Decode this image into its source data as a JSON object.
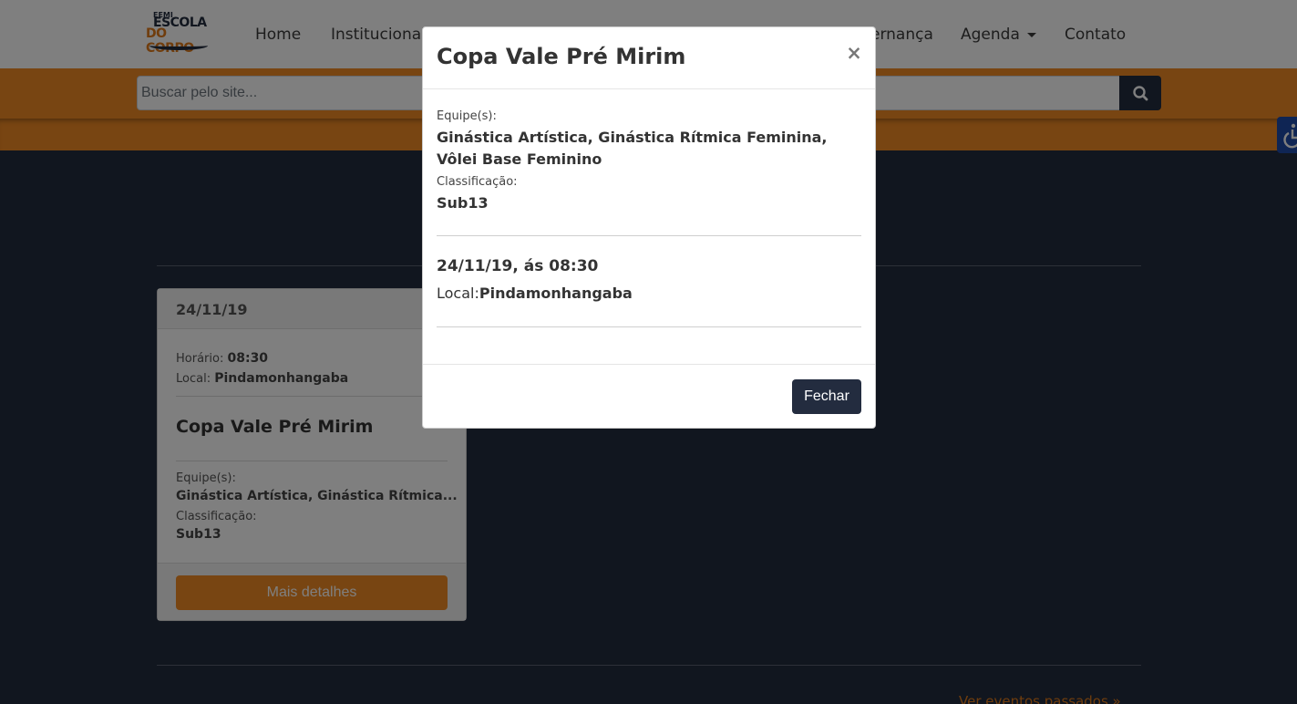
{
  "navbar": {
    "logo": {
      "line1": "EEMI",
      "line2": "ESCOLA",
      "line3": "DO CORPO"
    },
    "links": [
      "Home",
      "Institucional",
      "ernança",
      "Agenda",
      "Contato"
    ]
  },
  "search": {
    "placeholder": "Buscar pelo site...",
    "button_icon": "search-icon"
  },
  "accessibility": {
    "icon": "wheelchair-icon",
    "color": "#1f4aa8"
  },
  "event_card": {
    "date": "24/11/19",
    "time_label": "Horário:",
    "time": "08:30",
    "local_label": "Local:",
    "local": "Pindamonhangaba",
    "title": "Copa Vale Pré Mirim",
    "teams_label": "Equipe(s):",
    "teams": "Ginástica Artística, Ginástica Rítmica...",
    "class_label": "Classificação:",
    "class": "Sub13",
    "button": "Mais detalhes"
  },
  "past_events_link": "Ver eventos passados »",
  "modal": {
    "title": "Copa Vale Pré Mirim",
    "close": "×",
    "teams_label": "Equipe(s):",
    "teams": "Ginástica Artística, Ginástica Rítmica Feminina, Vôlei Base Feminino",
    "class_label": "Classificação:",
    "class": "Sub13",
    "datetime": "24/11/19, ás 08:30",
    "local_label": "Local:",
    "local": "Pindamonhangaba",
    "close_button": "Fechar"
  },
  "colors": {
    "brand_orange": "#f08a24",
    "brand_navy": "#232c3f"
  }
}
